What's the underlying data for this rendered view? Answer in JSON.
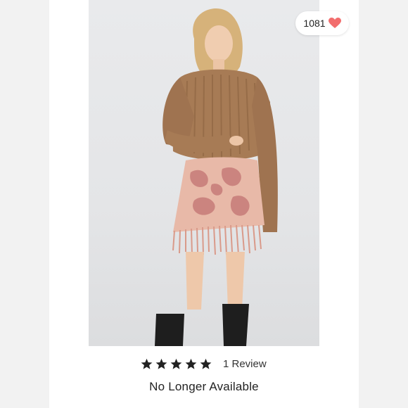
{
  "listing": {
    "like_count": "1081",
    "rating_stars": 5,
    "review_label": "1 Review",
    "availability": "No Longer Available"
  },
  "icons": {
    "like": "heart-icon",
    "star": "star-icon"
  },
  "colors": {
    "heart": "#f26d6d",
    "star": "#222222",
    "sweater": "#a77b55",
    "skirt_base": "#e8b9a8",
    "skirt_pattern": "#c77b78",
    "boots": "#1e1e1e"
  }
}
